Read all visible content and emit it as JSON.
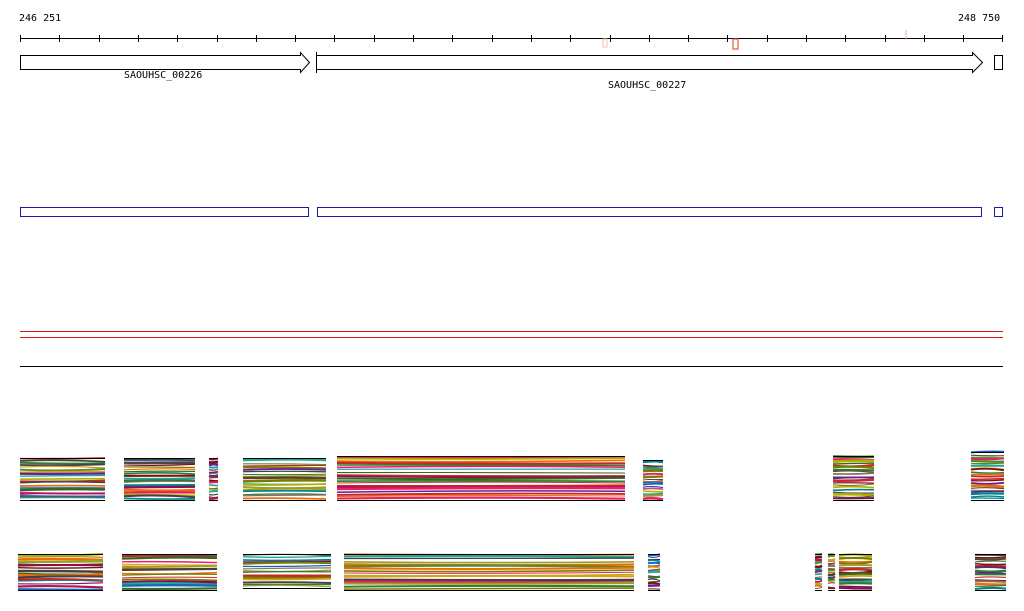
{
  "coordinates": {
    "start": "246 251",
    "end": "248 750"
  },
  "genes": [
    {
      "id": "SAOUHSC_00226",
      "label": "SAOUHSC_00226",
      "strand": "+"
    },
    {
      "id": "SAOUHSC_00227",
      "label": "SAOUHSC_00227",
      "strand": "+"
    },
    {
      "id": "partial",
      "label": "",
      "strand": "+"
    }
  ],
  "colors": {
    "gene_outline": "#000000",
    "feature_outline": "#1a1aa8",
    "red_track": "#d81818",
    "marker": "#e06030",
    "baseline": "#000000"
  },
  "alignment_palette": [
    "#7a1010",
    "#2e7d32",
    "#9e9d24",
    "#6a1b9a",
    "#c62828",
    "#1565c0",
    "#8d6e63",
    "#ad1457",
    "#558b2f",
    "#ef6c00",
    "#00838f",
    "#424242",
    "#b0b000",
    "#5d4037",
    "#e91e63",
    "#33691e",
    "#7b7b00",
    "#880e4f",
    "#26a69a",
    "#d4a017"
  ]
}
